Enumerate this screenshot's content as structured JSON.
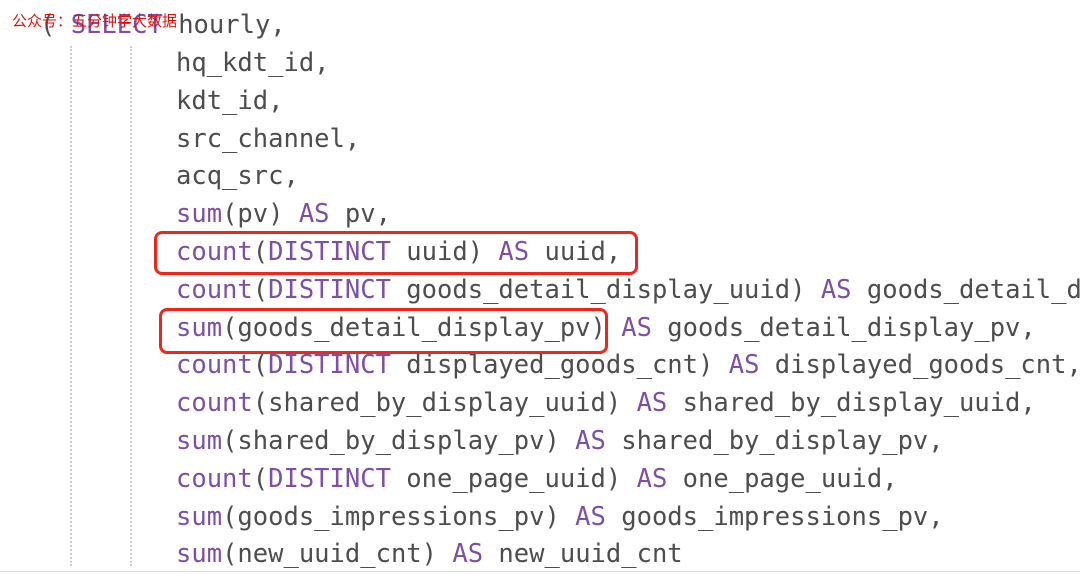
{
  "watermark": "公众号：五分钟学大数据",
  "first_line": {
    "paren": "(",
    "keyword": "SELECT",
    "rest": " hourly,"
  },
  "lines": [
    [
      {
        "t": "hq_kdt_id,",
        "k": false
      }
    ],
    [
      {
        "t": "kdt_id,",
        "k": false
      }
    ],
    [
      {
        "t": "src_channel,",
        "k": false
      }
    ],
    [
      {
        "t": "acq_src,",
        "k": false
      }
    ],
    [
      {
        "t": "sum",
        "k": true
      },
      {
        "t": "(pv) ",
        "k": false
      },
      {
        "t": "AS",
        "k": true
      },
      {
        "t": " pv,",
        "k": false
      }
    ],
    [
      {
        "t": "count",
        "k": true
      },
      {
        "t": "(",
        "k": false
      },
      {
        "t": "DISTINCT",
        "k": true
      },
      {
        "t": " uuid) ",
        "k": false
      },
      {
        "t": "AS",
        "k": true
      },
      {
        "t": " uuid,",
        "k": false
      }
    ],
    [
      {
        "t": "count",
        "k": true
      },
      {
        "t": "(",
        "k": false
      },
      {
        "t": "DISTINCT",
        "k": true
      },
      {
        "t": " goods_detail_display_uuid) ",
        "k": false
      },
      {
        "t": "AS",
        "k": true
      },
      {
        "t": " goods_detail_di",
        "k": false
      }
    ],
    [
      {
        "t": "sum",
        "k": true
      },
      {
        "t": "(goods_detail_display_pv) ",
        "k": false
      },
      {
        "t": "AS",
        "k": true
      },
      {
        "t": " goods_detail_display_pv,",
        "k": false
      }
    ],
    [
      {
        "t": "count",
        "k": true
      },
      {
        "t": "(",
        "k": false
      },
      {
        "t": "DISTINCT",
        "k": true
      },
      {
        "t": " displayed_goods_cnt) ",
        "k": false
      },
      {
        "t": "AS",
        "k": true
      },
      {
        "t": " displayed_goods_cnt,",
        "k": false
      }
    ],
    [
      {
        "t": "count",
        "k": true
      },
      {
        "t": "(shared_by_display_uuid) ",
        "k": false
      },
      {
        "t": "AS",
        "k": true
      },
      {
        "t": " shared_by_display_uuid,",
        "k": false
      }
    ],
    [
      {
        "t": "sum",
        "k": true
      },
      {
        "t": "(shared_by_display_pv) ",
        "k": false
      },
      {
        "t": "AS",
        "k": true
      },
      {
        "t": " shared_by_display_pv,",
        "k": false
      }
    ],
    [
      {
        "t": "count",
        "k": true
      },
      {
        "t": "(",
        "k": false
      },
      {
        "t": "DISTINCT",
        "k": true
      },
      {
        "t": " one_page_uuid) ",
        "k": false
      },
      {
        "t": "AS",
        "k": true
      },
      {
        "t": " one_page_uuid,",
        "k": false
      }
    ],
    [
      {
        "t": "sum",
        "k": true
      },
      {
        "t": "(goods_impressions_pv) ",
        "k": false
      },
      {
        "t": "AS",
        "k": true
      },
      {
        "t": " goods_impressions_pv,",
        "k": false
      }
    ],
    [
      {
        "t": "sum",
        "k": true
      },
      {
        "t": "(new_uuid_cnt) ",
        "k": false
      },
      {
        "t": "AS",
        "k": true
      },
      {
        "t": " new_uuid_cnt",
        "k": false
      }
    ]
  ],
  "highlight_color": "#f0261c",
  "keyword_color": "#7d4fa6"
}
